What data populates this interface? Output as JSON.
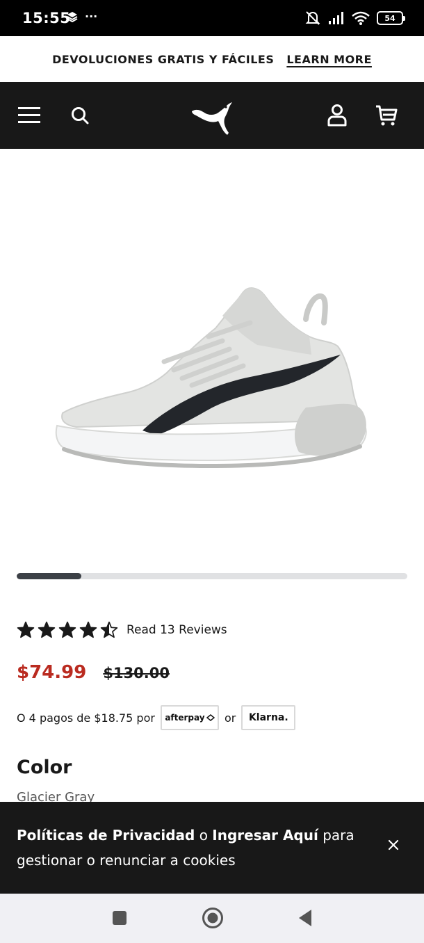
{
  "status_bar": {
    "time": "15:55",
    "battery": "54",
    "more": "···"
  },
  "promo": {
    "text": "DEVOLUCIONES GRATIS Y FÁCILES",
    "link": "LEARN MORE"
  },
  "header": {
    "menu_icon": "hamburger-menu-icon",
    "search_icon": "search-icon",
    "logo": "puma-logo",
    "account_icon": "user-icon",
    "cart_icon": "cart-icon",
    "background": "#181818"
  },
  "product": {
    "image": "white-gray-basketball-shoe",
    "carousel_progress": 0.165,
    "rating": 4.5,
    "rating_max": 5,
    "reviews_link": "Read 13 Reviews",
    "sale_price": "$74.99",
    "original_price": "$130.00",
    "sale_color": "#ba2b20",
    "installments_text": "O 4 pagos de $18.75 por",
    "afterpay_label": "afterpay",
    "or_text": "or",
    "klarna_label": "Klarna.",
    "color_title": "Color",
    "color_value": "Glacier Gray"
  },
  "cookie_banner": {
    "privacy_link": "Políticas de Privacidad",
    "connector": " o ",
    "login_link": "Ingresar Aquí",
    "rest": " para gestionar o renunciar a cookies",
    "close_icon": "close-icon"
  },
  "nav_bar": {
    "recents": "square-recents-icon",
    "home": "circle-home-icon",
    "back": "triangle-back-icon"
  }
}
